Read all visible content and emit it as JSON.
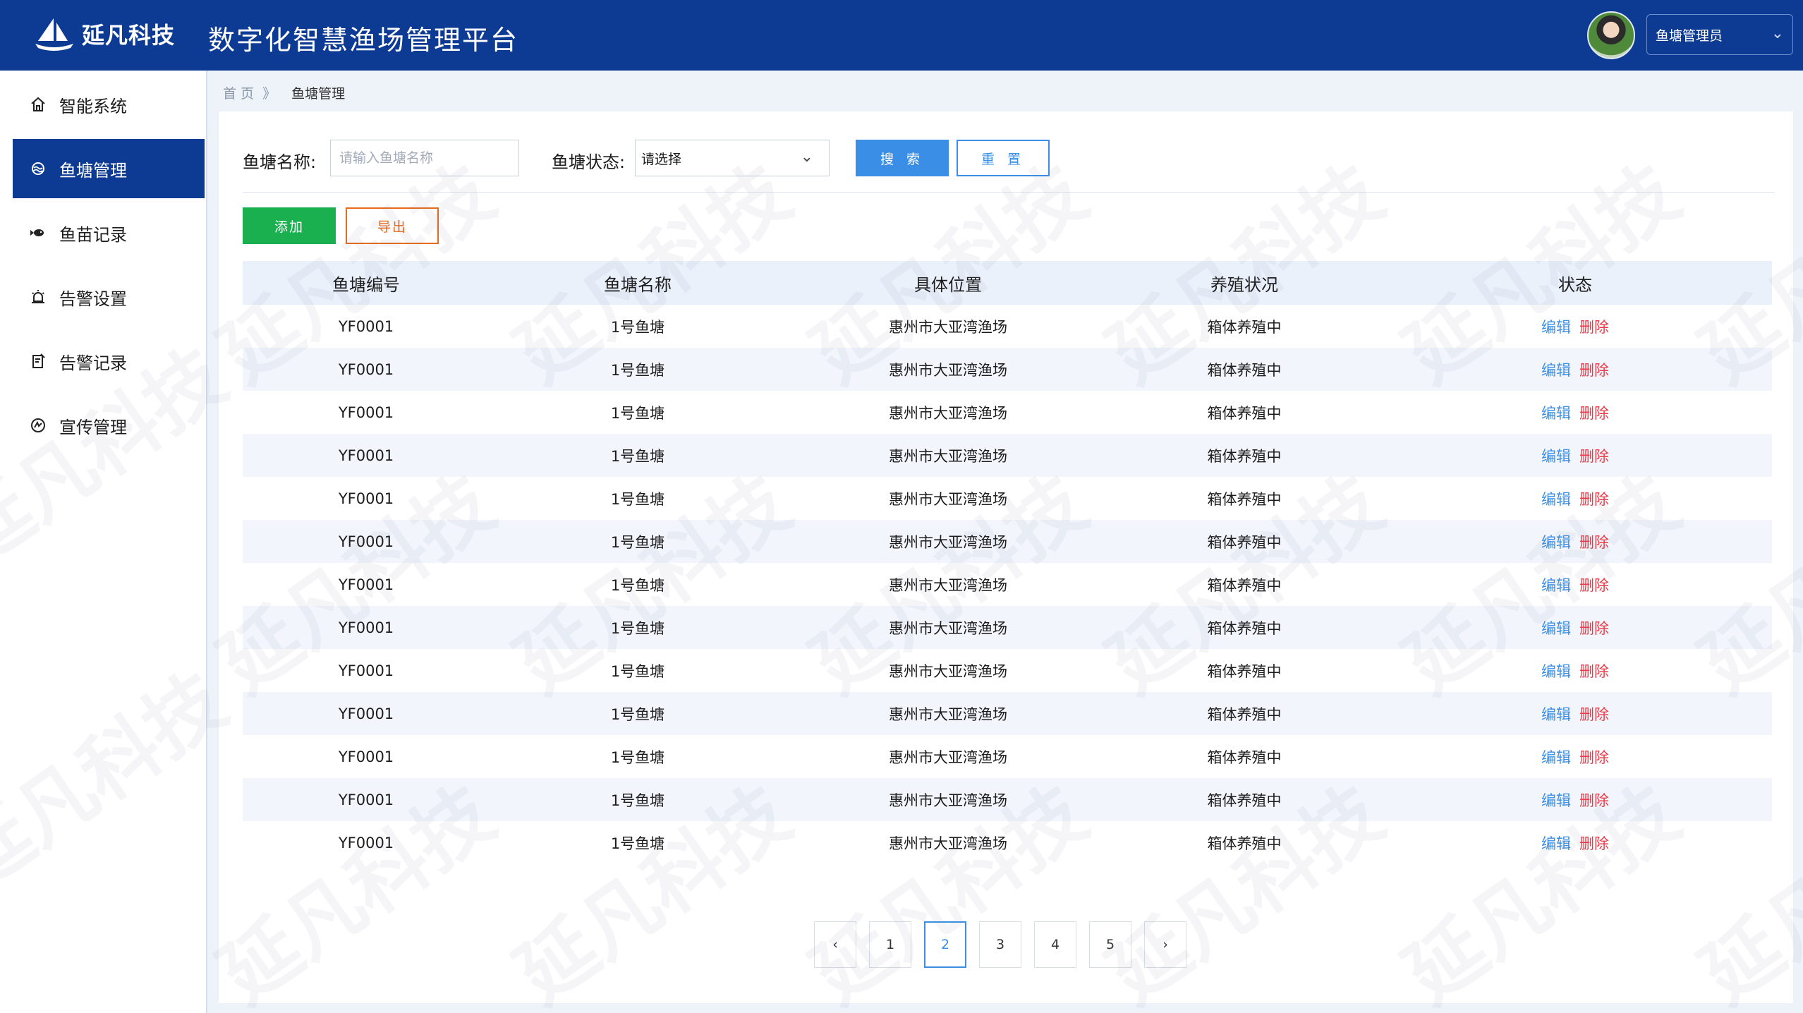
{
  "header": {
    "logo_text": "延凡科技",
    "app_title": "数字化智慧渔场管理平台",
    "user_role": "鱼塘管理员"
  },
  "sidebar": {
    "items": [
      {
        "label": "智能系统",
        "icon": "home-icon"
      },
      {
        "label": "鱼塘管理",
        "icon": "pond-icon",
        "active": true
      },
      {
        "label": "鱼苗记录",
        "icon": "fish-icon"
      },
      {
        "label": "告警设置",
        "icon": "alarm-icon"
      },
      {
        "label": "告警记录",
        "icon": "record-icon"
      },
      {
        "label": "宣传管理",
        "icon": "megaphone-icon"
      }
    ]
  },
  "breadcrumb": {
    "home": "首 页",
    "separator": "》",
    "current": "鱼塘管理"
  },
  "filters": {
    "name_label": "鱼塘名称:",
    "name_placeholder": "请输入鱼塘名称",
    "status_label": "鱼塘状态:",
    "status_value": "请选择",
    "search_label": "搜 索",
    "reset_label": "重 置"
  },
  "actions": {
    "add_label": "添加",
    "export_label": "导出"
  },
  "table": {
    "columns": [
      "鱼塘编号",
      "鱼塘名称",
      "具体位置",
      "养殖状况",
      "状态"
    ],
    "rows": [
      {
        "id": "YF0001",
        "name": "1号鱼塘",
        "location": "惠州市大亚湾渔场",
        "status": "箱体养殖中"
      },
      {
        "id": "YF0001",
        "name": "1号鱼塘",
        "location": "惠州市大亚湾渔场",
        "status": "箱体养殖中"
      },
      {
        "id": "YF0001",
        "name": "1号鱼塘",
        "location": "惠州市大亚湾渔场",
        "status": "箱体养殖中"
      },
      {
        "id": "YF0001",
        "name": "1号鱼塘",
        "location": "惠州市大亚湾渔场",
        "status": "箱体养殖中"
      },
      {
        "id": "YF0001",
        "name": "1号鱼塘",
        "location": "惠州市大亚湾渔场",
        "status": "箱体养殖中"
      },
      {
        "id": "YF0001",
        "name": "1号鱼塘",
        "location": "惠州市大亚湾渔场",
        "status": "箱体养殖中"
      },
      {
        "id": "YF0001",
        "name": "1号鱼塘",
        "location": "惠州市大亚湾渔场",
        "status": "箱体养殖中"
      },
      {
        "id": "YF0001",
        "name": "1号鱼塘",
        "location": "惠州市大亚湾渔场",
        "status": "箱体养殖中"
      },
      {
        "id": "YF0001",
        "name": "1号鱼塘",
        "location": "惠州市大亚湾渔场",
        "status": "箱体养殖中"
      },
      {
        "id": "YF0001",
        "name": "1号鱼塘",
        "location": "惠州市大亚湾渔场",
        "status": "箱体养殖中"
      },
      {
        "id": "YF0001",
        "name": "1号鱼塘",
        "location": "惠州市大亚湾渔场",
        "status": "箱体养殖中"
      },
      {
        "id": "YF0001",
        "name": "1号鱼塘",
        "location": "惠州市大亚湾渔场",
        "status": "箱体养殖中"
      },
      {
        "id": "YF0001",
        "name": "1号鱼塘",
        "location": "惠州市大亚湾渔场",
        "status": "箱体养殖中"
      }
    ],
    "edit_label": "编辑",
    "delete_label": "删除"
  },
  "pagination": {
    "pages": [
      "1",
      "2",
      "3",
      "4",
      "5"
    ],
    "current": "2",
    "prev_icon": "chevron-left-icon",
    "next_icon": "chevron-right-icon"
  },
  "watermark": "延凡科技",
  "colors": {
    "header_bg": "#0d3b94",
    "active_nav": "#0d3b94",
    "primary": "#3a8ee6",
    "add_green": "#1bb04f",
    "export_orange": "#e86a1d",
    "delete_red": "#ea3b48"
  }
}
